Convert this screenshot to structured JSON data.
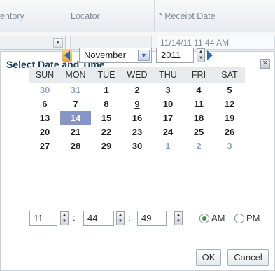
{
  "grid": {
    "columns": [
      "entory",
      "Locator",
      "* Receipt Date"
    ],
    "row": {
      "receipt_date": "11/14/11 11:44 AM"
    }
  },
  "dialog": {
    "title": "Select Date and Time",
    "month": "November",
    "year": "2011",
    "weekdays": [
      "SUN",
      "MON",
      "TUE",
      "WED",
      "THU",
      "FRI",
      "SAT"
    ],
    "weeks": [
      [
        "30",
        "31",
        "1",
        "2",
        "3",
        "4",
        "5"
      ],
      [
        "6",
        "7",
        "8",
        "9",
        "10",
        "11",
        "12"
      ],
      [
        "13",
        "14",
        "15",
        "16",
        "17",
        "18",
        "19"
      ],
      [
        "20",
        "21",
        "22",
        "23",
        "24",
        "25",
        "26"
      ],
      [
        "27",
        "28",
        "29",
        "30",
        "1",
        "2",
        "3"
      ]
    ],
    "selected_day": "14",
    "today_day": "9",
    "time": {
      "hour": "11",
      "minute": "44",
      "second": "49",
      "separator": ":"
    },
    "meridiem": {
      "am_label": "AM",
      "pm_label": "PM",
      "selected": "AM"
    },
    "buttons": {
      "ok": "OK",
      "cancel": "Cancel"
    },
    "colors": {
      "accent": "#2a66b8",
      "selected_bg": "#8694c8",
      "other_month": "#8aa0c6",
      "title": "#1e3f5a"
    },
    "icons": {
      "prev": "prev-month-icon",
      "next": "next-month-icon",
      "close": "close-icon"
    }
  }
}
